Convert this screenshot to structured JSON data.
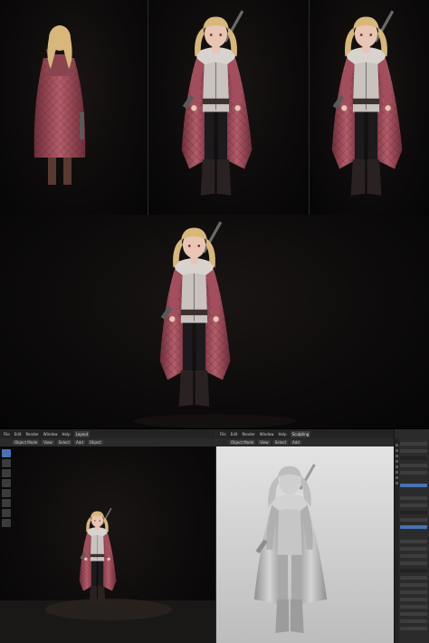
{
  "blender_left": {
    "topbar": {
      "menus": [
        "File",
        "Edit",
        "Render",
        "Window",
        "Help"
      ],
      "tab": "Layout"
    },
    "header": {
      "buttons": [
        "Object Mode",
        "View",
        "Select",
        "Add",
        "Object"
      ]
    },
    "tools": [
      "select-box-icon",
      "cursor-icon",
      "move-icon",
      "rotate-icon",
      "scale-icon",
      "transform-icon",
      "annotate-icon",
      "measure-icon"
    ]
  },
  "blender_right": {
    "topbar": {
      "menus": [
        "File",
        "Edit",
        "Render",
        "Window",
        "Help"
      ],
      "tab": "Sculpting"
    },
    "header": {
      "buttons": [
        "Object Mode",
        "View",
        "Select",
        "Add",
        "Object"
      ]
    }
  },
  "colors": {
    "coat": "#a24e5c",
    "coat_dark": "#6e2d3a",
    "hair": "#d8b77a",
    "shirt": "#c9c3c0",
    "pants": "#1c1a1c",
    "boots": "#2a2222",
    "skin": "#e8c5b4",
    "clay": "#b9b9b9",
    "blender_accent": "#4772b3"
  }
}
